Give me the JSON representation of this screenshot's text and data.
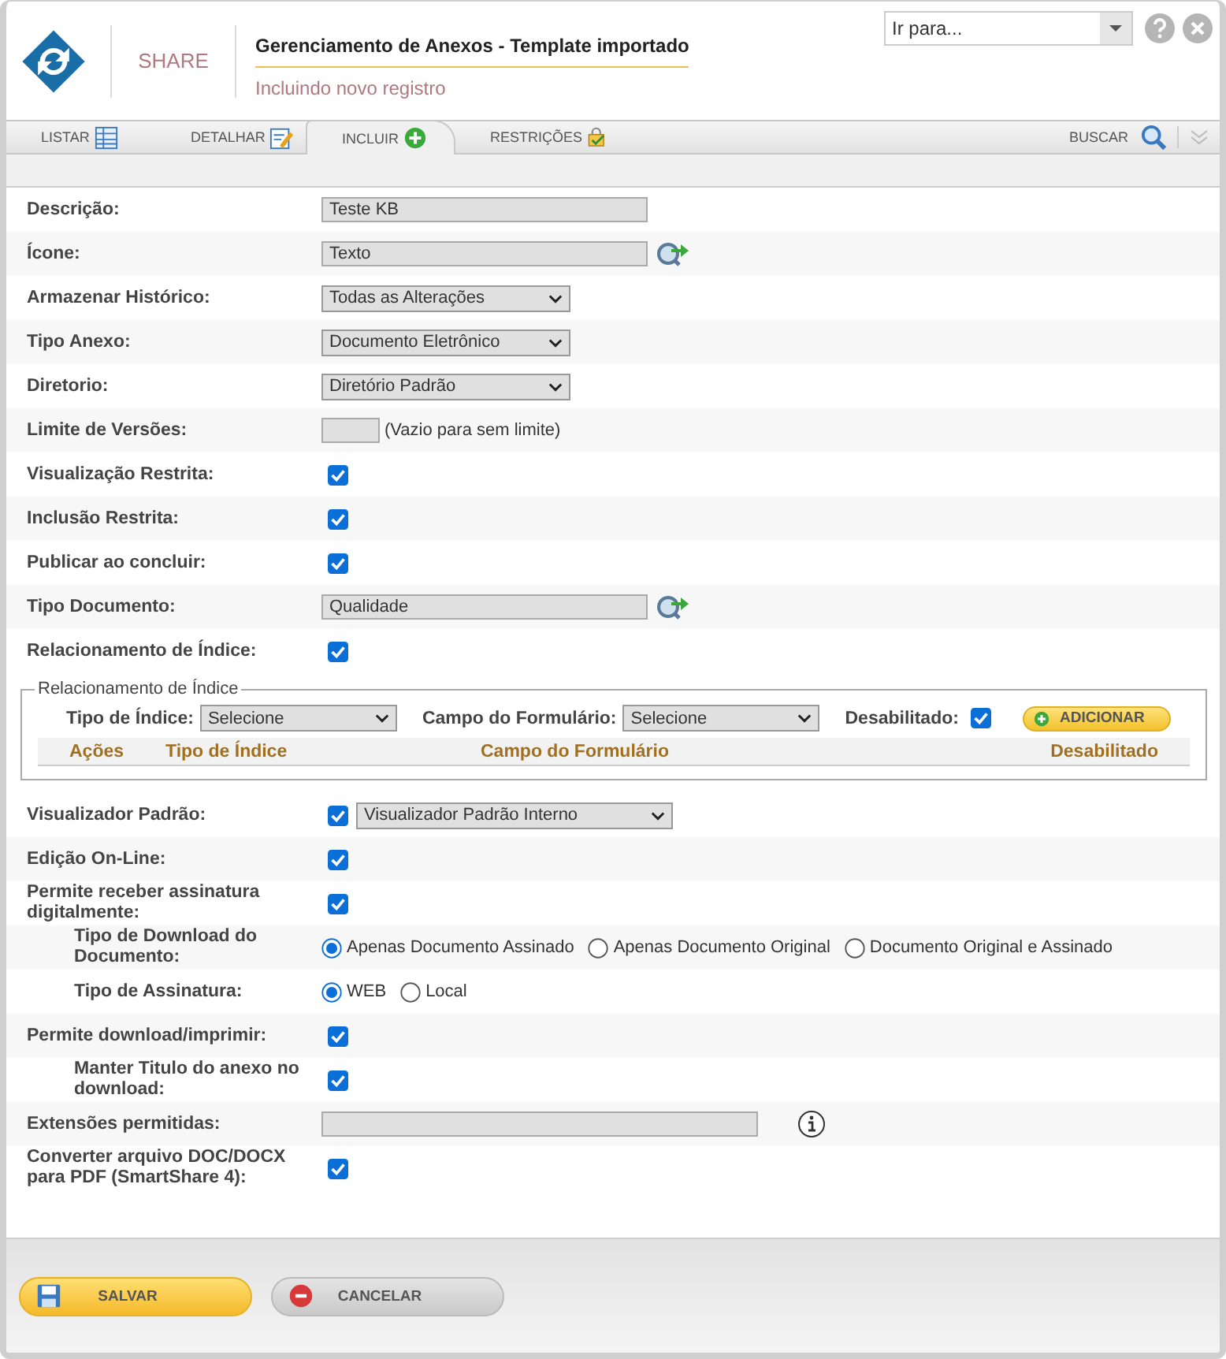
{
  "header": {
    "logo_text": "SHARE",
    "title": "Gerenciamento de Anexos - Template importado",
    "subtitle": "Incluindo novo registro",
    "goto": "Ir para..."
  },
  "tabs": [
    {
      "label": "LISTAR",
      "kind": "list",
      "selected": false
    },
    {
      "label": "DETALHAR",
      "kind": "detail",
      "selected": false
    },
    {
      "label": "INCLUIR",
      "kind": "add",
      "selected": true
    },
    {
      "label": "RESTRIÇÕES",
      "kind": "restrict",
      "selected": false
    }
  ],
  "search_label": "BUSCAR",
  "rows": [
    {
      "label": "Descrição:",
      "kind": "text",
      "value": "Teste KB"
    },
    {
      "label": "Ícone:",
      "kind": "lookup",
      "value": "Texto"
    },
    {
      "label": "Armazenar Histórico:",
      "kind": "select",
      "value": "Todas as Alterações"
    },
    {
      "label": "Tipo Anexo:",
      "kind": "select",
      "value": "Documento Eletrônico"
    },
    {
      "label": "Diretorio:",
      "kind": "select",
      "value": "Diretório Padrão"
    },
    {
      "label": "Limite de Versões:",
      "kind": "number",
      "hint": "(Vazio para sem limite)"
    },
    {
      "label": "Visualização Restrita:",
      "kind": "checkbox",
      "checked": true
    },
    {
      "label": "Inclusão Restrita:",
      "kind": "checkbox",
      "checked": true
    },
    {
      "label": "Publicar ao concluir:",
      "kind": "checkbox",
      "checked": true
    },
    {
      "label": "Tipo Documento:",
      "kind": "lookup",
      "value": "Qualidade"
    },
    {
      "label": "Relacionamento de Índice:",
      "kind": "checkbox",
      "checked": true
    }
  ],
  "index_section": {
    "legend": "Relacionamento de Índice",
    "filters": [
      {
        "label": "Tipo de Índice:",
        "value": "Selecione"
      },
      {
        "label": "Campo do Formulário:",
        "value": "Selecione"
      }
    ],
    "disabled_label": "Desabilitado:",
    "disabled_checked": true,
    "add_button": "ADICIONAR",
    "columns": [
      "Ações",
      "Tipo de Índice",
      "Campo do Formulário",
      "Desabilitado"
    ]
  },
  "rows_after": [
    {
      "label": "Visualizador Padrão:",
      "kind": "checkbox_select",
      "checked": true,
      "value": "Visualizador Padrão Interno"
    },
    {
      "label": "Edição On-Line:",
      "kind": "checkbox",
      "checked": true
    },
    {
      "label": "Permite receber assinatura digitalmente:",
      "kind": "checkbox",
      "checked": true
    },
    {
      "label": "Tipo de Download do Documento:",
      "kind": "radio",
      "indented": true,
      "options": [
        {
          "label": "Apenas Documento Assinado",
          "selected": true
        },
        {
          "label": "Apenas Documento Original",
          "selected": false
        },
        {
          "label": "Documento Original e Assinado",
          "selected": false
        }
      ]
    },
    {
      "label": "Tipo de Assinatura:",
      "kind": "radio",
      "indented": true,
      "options": [
        {
          "label": "WEB",
          "selected": true
        },
        {
          "label": "Local",
          "selected": false
        }
      ]
    },
    {
      "label": "Permite download/imprimir:",
      "kind": "checkbox",
      "checked": true
    },
    {
      "label": "Manter Titulo do anexo no download:",
      "kind": "checkbox",
      "indented": true,
      "checked": true
    },
    {
      "label": "Extensões permitidas:",
      "kind": "info_field"
    },
    {
      "label": "Converter arquivo DOC/DOCX para PDF (SmartShare 4):",
      "kind": "checkbox",
      "checked": true
    }
  ],
  "buttons": [
    {
      "label": "SALVAR",
      "kind": "save"
    },
    {
      "label": "CANCELAR",
      "kind": "cancel"
    }
  ]
}
